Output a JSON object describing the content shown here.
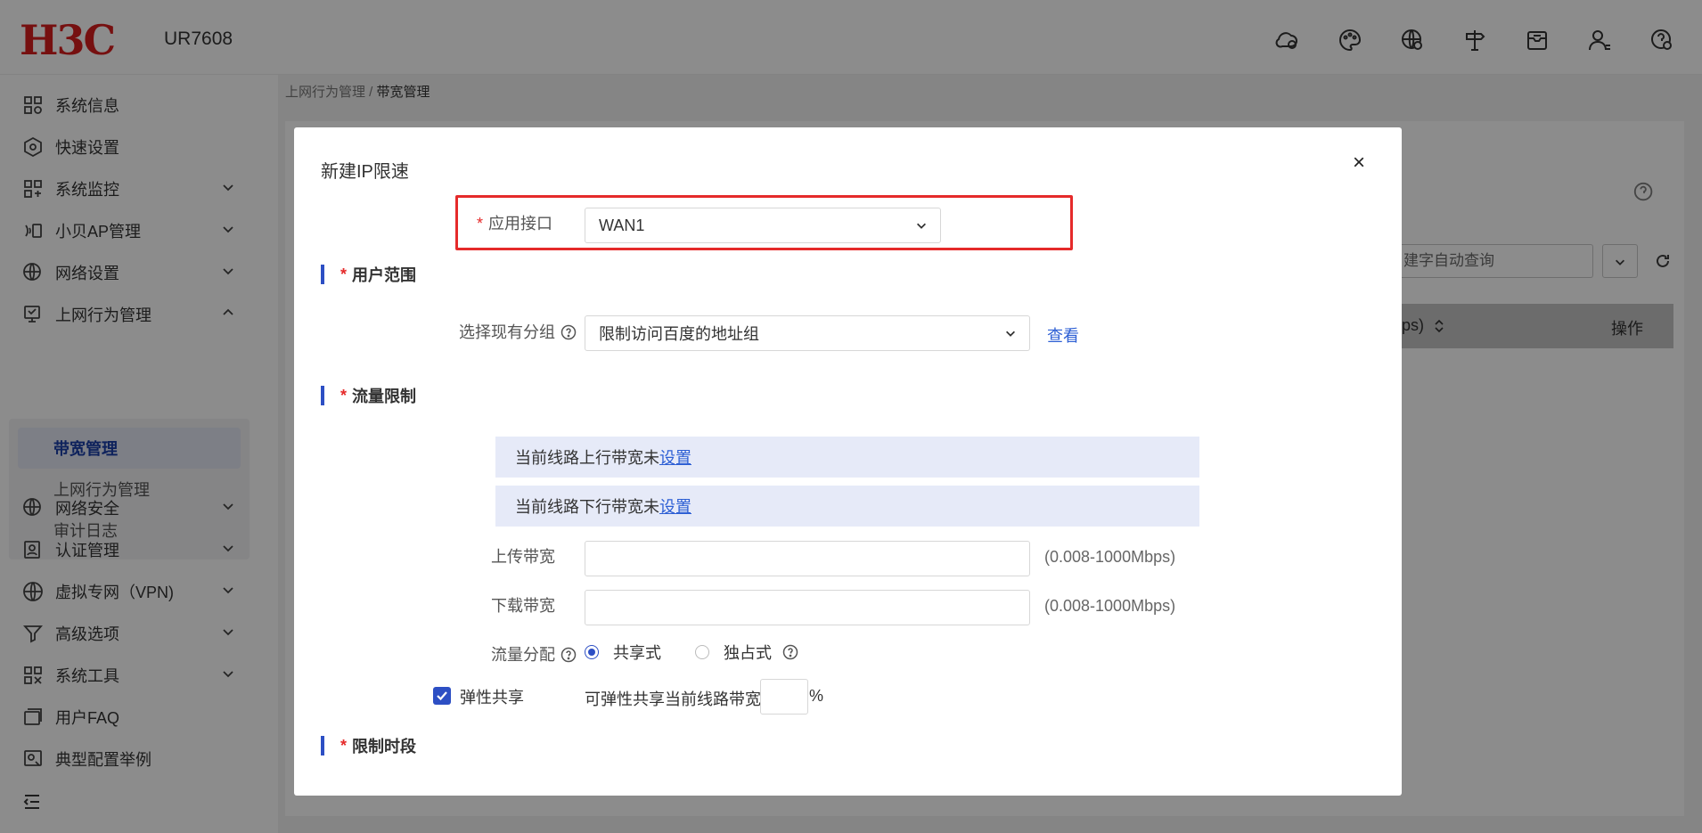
{
  "header": {
    "brand": "H3C",
    "model": "UR7608",
    "icons": [
      "cloud-icon",
      "theme-palette-icon",
      "globe-settings-icon",
      "signpost-icon",
      "mailbox-icon",
      "user-icon",
      "help-icon"
    ]
  },
  "sidebar": {
    "items": [
      {
        "label": "系统信息",
        "icon": "system-info-icon",
        "expandable": false
      },
      {
        "label": "快速设置",
        "icon": "quick-setup-icon",
        "expandable": false
      },
      {
        "label": "系统监控",
        "icon": "monitor-icon",
        "expandable": true
      },
      {
        "label": "小贝AP管理",
        "icon": "ap-icon",
        "expandable": true
      },
      {
        "label": "网络设置",
        "icon": "network-icon",
        "expandable": true
      },
      {
        "label": "上网行为管理",
        "icon": "behavior-icon",
        "expandable": true,
        "expanded": true
      },
      {
        "label": "网络安全",
        "icon": "security-icon",
        "expandable": true
      },
      {
        "label": "认证管理",
        "icon": "auth-icon",
        "expandable": true
      },
      {
        "label": "虚拟专网（VPN)",
        "icon": "vpn-icon",
        "expandable": true
      },
      {
        "label": "高级选项",
        "icon": "advanced-icon",
        "expandable": true
      },
      {
        "label": "系统工具",
        "icon": "tools-icon",
        "expandable": true
      },
      {
        "label": "用户FAQ",
        "icon": "faq-icon",
        "expandable": false
      },
      {
        "label": "典型配置举例",
        "icon": "example-icon",
        "expandable": false
      }
    ],
    "submenu": [
      {
        "label": "带宽管理",
        "active": true
      },
      {
        "label": "上网行为管理",
        "active": false
      },
      {
        "label": "审计日志",
        "active": false
      }
    ]
  },
  "breadcrumb": {
    "parent": "上网行为管理 /",
    "current": "带宽管理"
  },
  "background": {
    "search_placeholder": "建字自动查询",
    "column_header": "ps)",
    "operation_header": "操作"
  },
  "modal": {
    "title": "新建IP限速",
    "close": "×",
    "interface": {
      "required_mark": "*",
      "label": "应用接口",
      "value": "WAN1"
    },
    "user_scope": {
      "section_label": "用户范围",
      "group_label": "选择现有分组",
      "group_value": "限制访问百度的地址组",
      "view_link": "查看"
    },
    "traffic_limit": {
      "section_label": "流量限制",
      "upstream_notice": "当前线路上行带宽未",
      "downstream_notice": "当前线路下行带宽未",
      "set_link": "设置",
      "upload_label": "上传带宽",
      "upload_value": "",
      "upload_hint": "(0.008-1000Mbps)",
      "download_label": "下载带宽",
      "download_value": "",
      "download_hint": "(0.008-1000Mbps)",
      "distribution_label": "流量分配",
      "shared_label": "共享式",
      "exclusive_label": "独占式",
      "selected": "共享式",
      "elastic_label": "弹性共享",
      "elastic_checked": true,
      "elastic_text": "可弹性共享当前线路带宽",
      "elastic_value": "",
      "percent": "%"
    },
    "time_limit": {
      "section_label": "限制时段"
    }
  },
  "colors": {
    "accent": "#2d4fc4",
    "required": "#e52a2a",
    "brand": "#d81e1e",
    "link": "#2d5fd4"
  }
}
